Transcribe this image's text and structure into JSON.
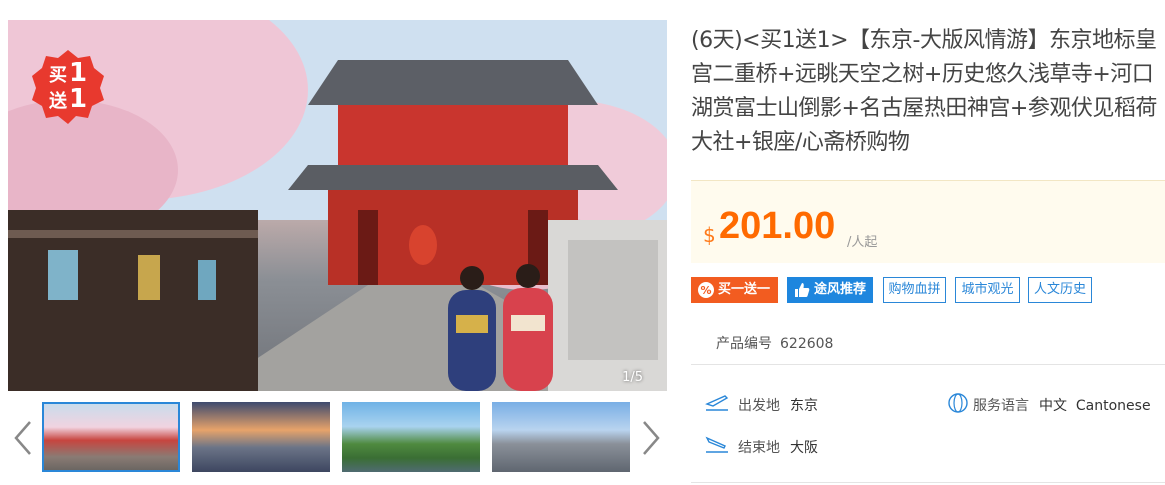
{
  "gallery": {
    "promo": {
      "buy": "买",
      "buy_num": "1",
      "get": "送",
      "get_num": "1"
    },
    "counter": "1/5",
    "thumbnails": [
      "temple",
      "city-skyline",
      "castle-park",
      "tokyo-skyline"
    ]
  },
  "product": {
    "title": "(6天)<买1送1>【东京-大版风情游】东京地标皇宫二重桥+远眺天空之树+历史悠久浅草寺+河口湖赏富士山倒影+名古屋热田神宫+参观伏见稻荷大社+银座/心斋桥购物",
    "price": {
      "currency": "$",
      "amount": "201.00",
      "unit": "/人起"
    },
    "tags": [
      "买一送一",
      "途风推荐",
      "购物血拼",
      "城市观光",
      "人文历史"
    ],
    "code_label": "产品编号",
    "code": "622608",
    "departure_label": "出发地",
    "departure": "东京",
    "end_label": "结束地",
    "end": "大阪",
    "language_label": "服务语言",
    "languages": "中文  Cantonese"
  },
  "colors": {
    "accent_orange": "#ff6a00",
    "brand_blue": "#2a87d8",
    "promo_red": "#e8392e"
  }
}
